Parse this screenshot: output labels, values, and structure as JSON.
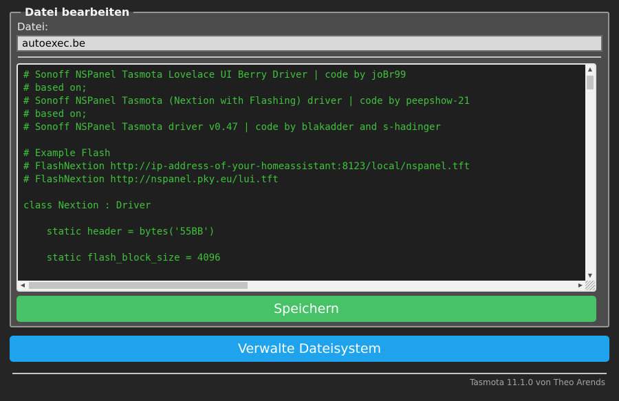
{
  "colors": {
    "page_bg": "#252525",
    "form_bg": "#4c4c4c",
    "text": "#eaeaea",
    "input_bg": "#d9d9d9",
    "input_text": "#000000",
    "code_bg": "#1f1f1f",
    "code_text": "#3fc13c",
    "save_button": "#47c266",
    "manage_button": "#1fa3ec",
    "button_text": "#faffff",
    "footer_text": "#a3a3a3"
  },
  "editor": {
    "legend": "Datei bearbeiten",
    "file_label": "Datei:",
    "file_name": "autoexec.be",
    "code_lines": [
      "# Sonoff NSPanel Tasmota Lovelace UI Berry Driver | code by joBr99",
      "# based on;",
      "# Sonoff NSPanel Tasmota (Nextion with Flashing) driver | code by peepshow-21",
      "# based on;",
      "# Sonoff NSPanel Tasmota driver v0.47 | code by blakadder and s-hadinger",
      "",
      "# Example Flash",
      "# FlashNextion http://ip-address-of-your-homeassistant:8123/local/nspanel.tft",
      "# FlashNextion http://nspanel.pky.eu/lui.tft",
      "",
      "class Nextion : Driver",
      "",
      "    static header = bytes('55BB')",
      "",
      "    static flash_block_size = 4096"
    ]
  },
  "buttons": {
    "save": "Speichern",
    "manage_filesystem": "Verwalte Dateisystem"
  },
  "footer": {
    "text": "Tasmota 11.1.0 von Theo Arends"
  },
  "icons": {
    "up": "▲",
    "down": "▼",
    "left": "◀",
    "right": "▶"
  }
}
